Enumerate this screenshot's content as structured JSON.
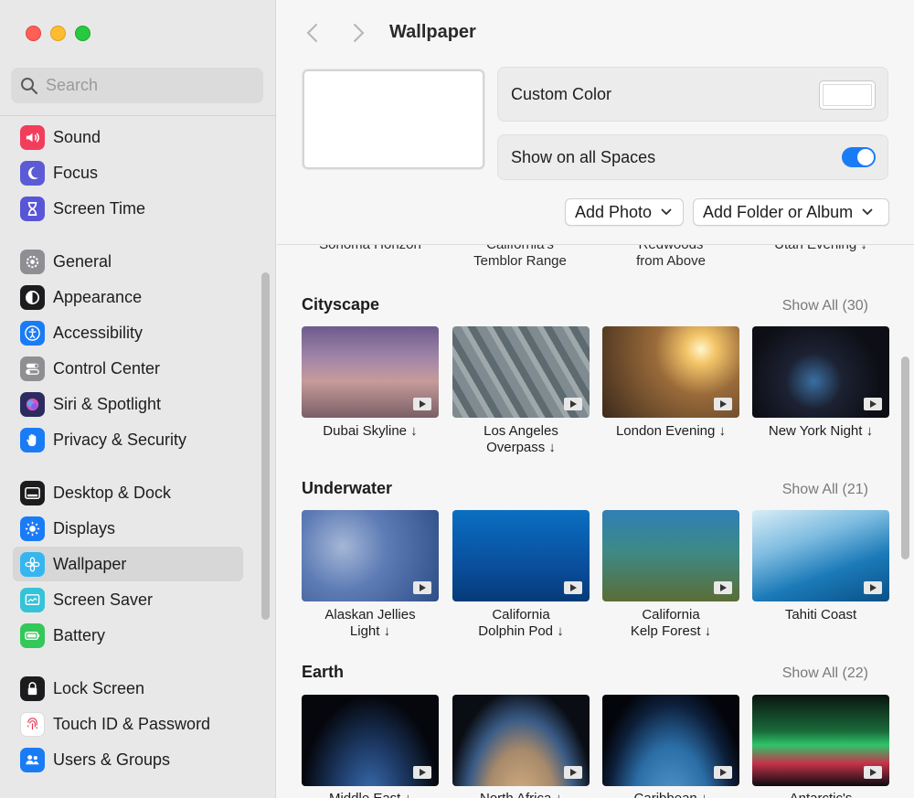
{
  "sidebar": {
    "search_placeholder": "Search",
    "items": [
      {
        "label": "Sound",
        "icon": "speaker-icon",
        "color": "#f23d5b"
      },
      {
        "label": "Focus",
        "icon": "moon-icon",
        "color": "#5b5bd6"
      },
      {
        "label": "Screen Time",
        "icon": "hourglass-icon",
        "color": "#5856d6"
      },
      {
        "label": "General",
        "icon": "gear-icon",
        "color": "#8e8e93"
      },
      {
        "label": "Appearance",
        "icon": "appearance-icon",
        "color": "#1c1c1e"
      },
      {
        "label": "Accessibility",
        "icon": "accessibility-icon",
        "color": "#1a7cf5"
      },
      {
        "label": "Control Center",
        "icon": "toggles-icon",
        "color": "#8e8e93"
      },
      {
        "label": "Siri & Spotlight",
        "icon": "siri-icon",
        "color": "#2b2b60"
      },
      {
        "label": "Privacy & Security",
        "icon": "hand-icon",
        "color": "#1a7cf5"
      },
      {
        "label": "Desktop & Dock",
        "icon": "dock-icon",
        "color": "#1c1c1e"
      },
      {
        "label": "Displays",
        "icon": "sun-icon",
        "color": "#1a7cf5"
      },
      {
        "label": "Wallpaper",
        "icon": "flower-icon",
        "color": "#36b6f0"
      },
      {
        "label": "Screen Saver",
        "icon": "screensaver-icon",
        "color": "#34c3d8"
      },
      {
        "label": "Battery",
        "icon": "battery-icon",
        "color": "#34c759"
      },
      {
        "label": "Lock Screen",
        "icon": "lock-icon",
        "color": "#1c1c1e"
      },
      {
        "label": "Touch ID & Password",
        "icon": "fingerprint-icon",
        "color": "#ffffff"
      },
      {
        "label": "Users & Groups",
        "icon": "users-icon",
        "color": "#1a7cf5"
      }
    ],
    "selected": "Wallpaper"
  },
  "header": {
    "title": "Wallpaper",
    "custom_color_label": "Custom Color",
    "show_spaces_label": "Show on all Spaces",
    "show_spaces_on": true,
    "add_photo_label": "Add Photo",
    "add_folder_label": "Add Folder or Album"
  },
  "partial_row": [
    "Sonoma Horizon",
    "California's\nTemblor Range",
    "Redwoods\nfrom Above",
    "Utah Evening ↓"
  ],
  "sections": [
    {
      "title": "Cityscape",
      "show_all": "Show All (30)",
      "tiles": [
        {
          "caption": "Dubai Skyline ↓"
        },
        {
          "caption": "Los Angeles\nOverpass ↓"
        },
        {
          "caption": "London Evening ↓"
        },
        {
          "caption": "New York Night ↓"
        }
      ]
    },
    {
      "title": "Underwater",
      "show_all": "Show All (21)",
      "tiles": [
        {
          "caption": "Alaskan Jellies\nLight ↓"
        },
        {
          "caption": "California\nDolphin Pod ↓"
        },
        {
          "caption": "California\nKelp Forest ↓"
        },
        {
          "caption": "Tahiti Coast"
        }
      ]
    },
    {
      "title": "Earth",
      "show_all": "Show All (22)",
      "tiles": [
        {
          "caption": "Middle East ↓"
        },
        {
          "caption": "North Africa ↓"
        },
        {
          "caption": "Caribbean ↓"
        },
        {
          "caption": "Antarctic's"
        }
      ]
    }
  ]
}
